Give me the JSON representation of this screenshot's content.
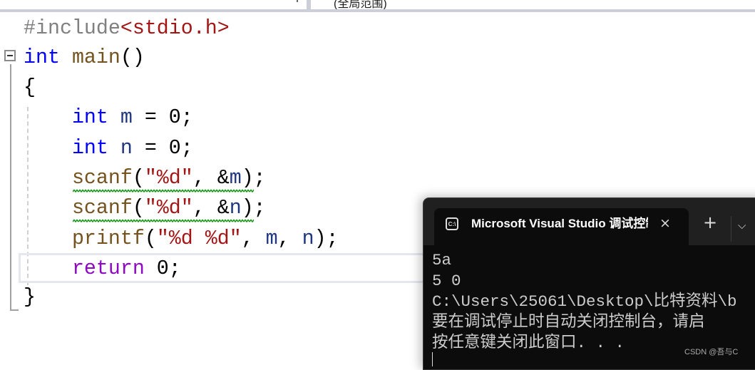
{
  "topbar": {
    "scope_label": "(全局范围)"
  },
  "editor": {
    "colors": {
      "keyword": "#0000ff",
      "function": "#74531f",
      "string": "#a31515",
      "variable": "#1f377f",
      "control": "#8f08c4",
      "preprocessor": "#808080",
      "default": "#000000"
    },
    "lines": [
      [
        {
          "t": "#include",
          "c": "#808080"
        },
        {
          "t": "<stdio.h>",
          "c": "#a31515"
        }
      ],
      [
        {
          "t": "int",
          "c": "#0000ff"
        },
        {
          "t": " ",
          "c": "#000"
        },
        {
          "t": "main",
          "c": "#74531f"
        },
        {
          "t": "()",
          "c": "#000"
        }
      ],
      [
        {
          "t": "{",
          "c": "#000"
        }
      ],
      [
        {
          "t": "    ",
          "c": "#000"
        },
        {
          "t": "int",
          "c": "#0000ff"
        },
        {
          "t": " ",
          "c": "#000"
        },
        {
          "t": "m",
          "c": "#1f377f"
        },
        {
          "t": " = 0;",
          "c": "#000"
        }
      ],
      [
        {
          "t": "    ",
          "c": "#000"
        },
        {
          "t": "int",
          "c": "#0000ff"
        },
        {
          "t": " ",
          "c": "#000"
        },
        {
          "t": "n",
          "c": "#1f377f"
        },
        {
          "t": " = 0;",
          "c": "#000"
        }
      ],
      [
        {
          "t": "    ",
          "c": "#000"
        },
        {
          "t": "scanf",
          "c": "#74531f"
        },
        {
          "t": "(",
          "c": "#000"
        },
        {
          "t": "\"%d\"",
          "c": "#a31515"
        },
        {
          "t": ", &",
          "c": "#000"
        },
        {
          "t": "m",
          "c": "#1f377f"
        },
        {
          "t": ");",
          "c": "#000"
        }
      ],
      [
        {
          "t": "    ",
          "c": "#000"
        },
        {
          "t": "scanf",
          "c": "#74531f"
        },
        {
          "t": "(",
          "c": "#000"
        },
        {
          "t": "\"%d\"",
          "c": "#a31515"
        },
        {
          "t": ", &",
          "c": "#000"
        },
        {
          "t": "n",
          "c": "#1f377f"
        },
        {
          "t": ");",
          "c": "#000"
        }
      ],
      [
        {
          "t": "    ",
          "c": "#000"
        },
        {
          "t": "printf",
          "c": "#74531f"
        },
        {
          "t": "(",
          "c": "#000"
        },
        {
          "t": "\"%d %d\"",
          "c": "#a31515"
        },
        {
          "t": ", ",
          "c": "#000"
        },
        {
          "t": "m",
          "c": "#1f377f"
        },
        {
          "t": ", ",
          "c": "#000"
        },
        {
          "t": "n",
          "c": "#1f377f"
        },
        {
          "t": ");",
          "c": "#000"
        }
      ],
      [
        {
          "t": "    ",
          "c": "#000"
        },
        {
          "t": "return",
          "c": "#8f08c4"
        },
        {
          "t": " 0;",
          "c": "#000"
        }
      ],
      [
        {
          "t": "}",
          "c": "#000"
        }
      ]
    ]
  },
  "terminal": {
    "tab_title": "Microsoft Visual Studio 调试控制台",
    "tab_icon": "console-icon",
    "close_icon": "×",
    "new_tab_icon": "+",
    "dropdown_icon": "⌵",
    "output": [
      "5a",
      "5 0",
      "C:\\Users\\25061\\Desktop\\比特资料\\b",
      "要在调试停止时自动关闭控制台，请启",
      "按任意键关闭此窗口. . ."
    ]
  },
  "watermark": "CSDN @吾与C"
}
